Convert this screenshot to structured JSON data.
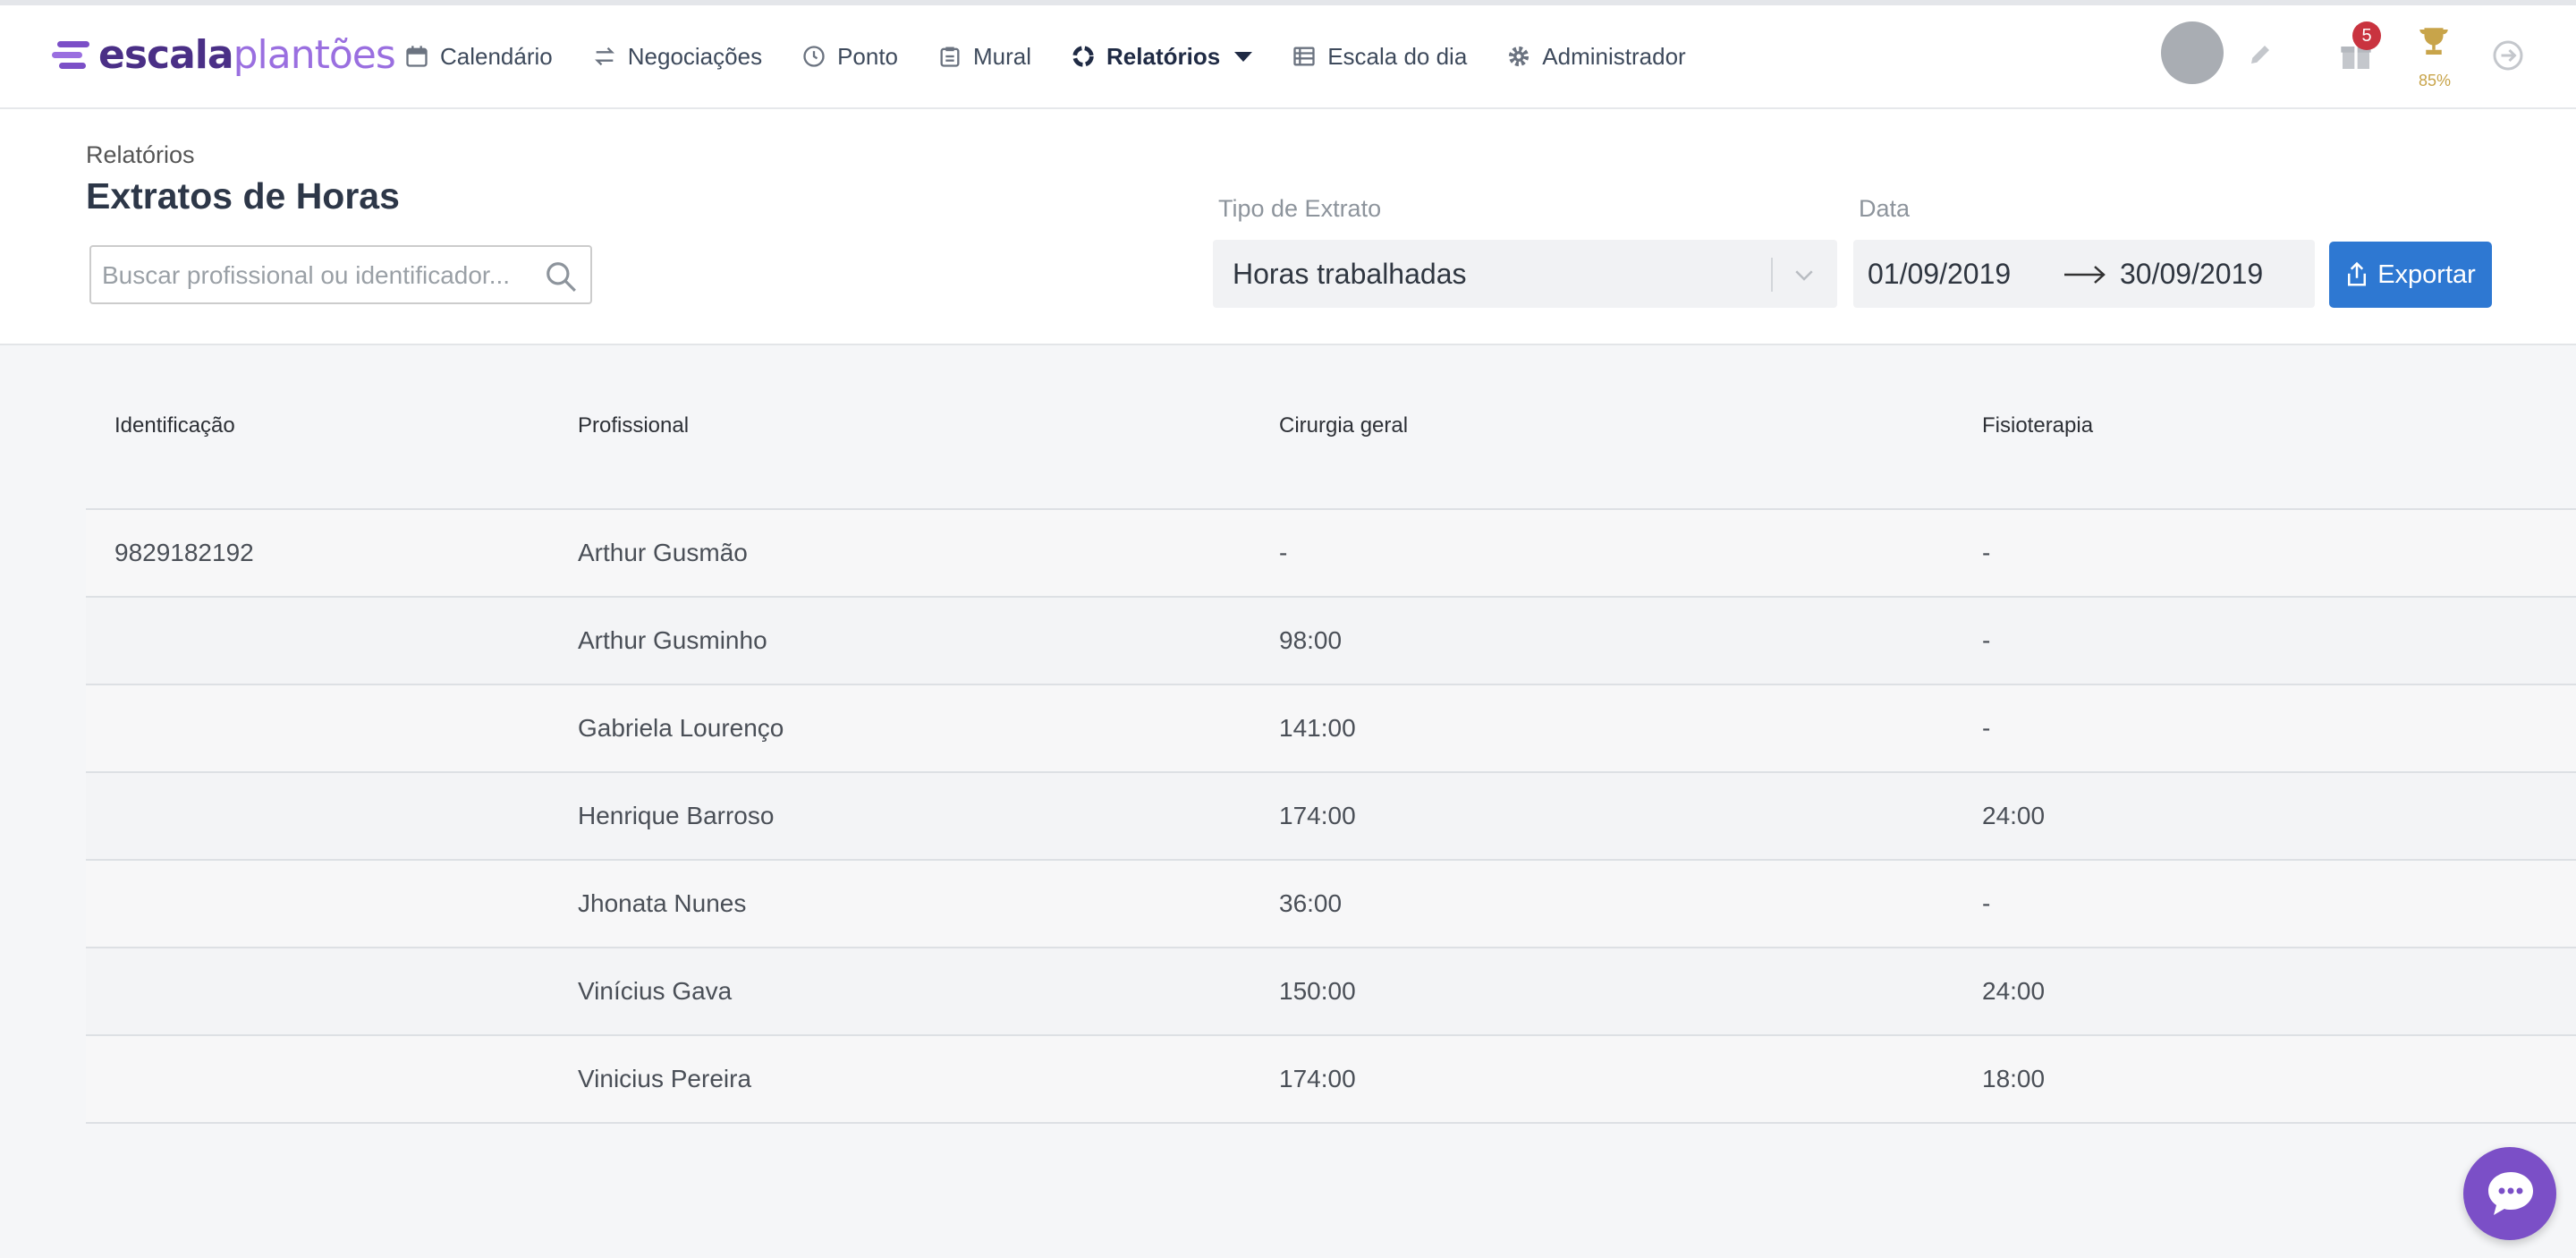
{
  "brand": {
    "part1": "escala",
    "part2": "plantões"
  },
  "nav": {
    "items": [
      {
        "label": "Calendário",
        "icon": "calendar-icon"
      },
      {
        "label": "Negociações",
        "icon": "exchange-icon"
      },
      {
        "label": "Ponto",
        "icon": "clock-icon"
      },
      {
        "label": "Mural",
        "icon": "clipboard-icon"
      },
      {
        "label": "Relatórios",
        "icon": "reports-icon",
        "active": true
      },
      {
        "label": "Escala do dia",
        "icon": "list-icon"
      },
      {
        "label": "Administrador",
        "icon": "gear-icon"
      }
    ],
    "notifications_count": "5",
    "trophy_percent": "85%"
  },
  "header": {
    "breadcrumb": "Relatórios",
    "title": "Extratos de Horas",
    "search_placeholder": "Buscar profissional ou identificador...",
    "extract_type_label": "Tipo de Extrato",
    "extract_type_value": "Horas trabalhadas",
    "date_label": "Data",
    "date_start": "01/09/2019",
    "date_end": "30/09/2019",
    "export_label": "Exportar"
  },
  "table": {
    "columns": [
      "Identificação",
      "Profissional",
      "Cirurgia geral",
      "Fisioterapia"
    ],
    "rows": [
      [
        "9829182192",
        "Arthur Gusmão",
        "-",
        "-"
      ],
      [
        "",
        "Arthur Gusminho",
        "98:00",
        "-"
      ],
      [
        "",
        "Gabriela Lourenço",
        "141:00",
        "-"
      ],
      [
        "",
        "Henrique Barroso",
        "174:00",
        "24:00"
      ],
      [
        "",
        "Jhonata Nunes",
        "36:00",
        "-"
      ],
      [
        "",
        "Vinícius Gava",
        "150:00",
        "24:00"
      ],
      [
        "",
        "Vinicius Pereira",
        "174:00",
        "18:00"
      ]
    ]
  },
  "colors": {
    "brand_purple": "#7b4fc7",
    "export_blue": "#2e78d2",
    "badge_red": "#c9333f",
    "trophy_gold": "#c8a44a"
  }
}
